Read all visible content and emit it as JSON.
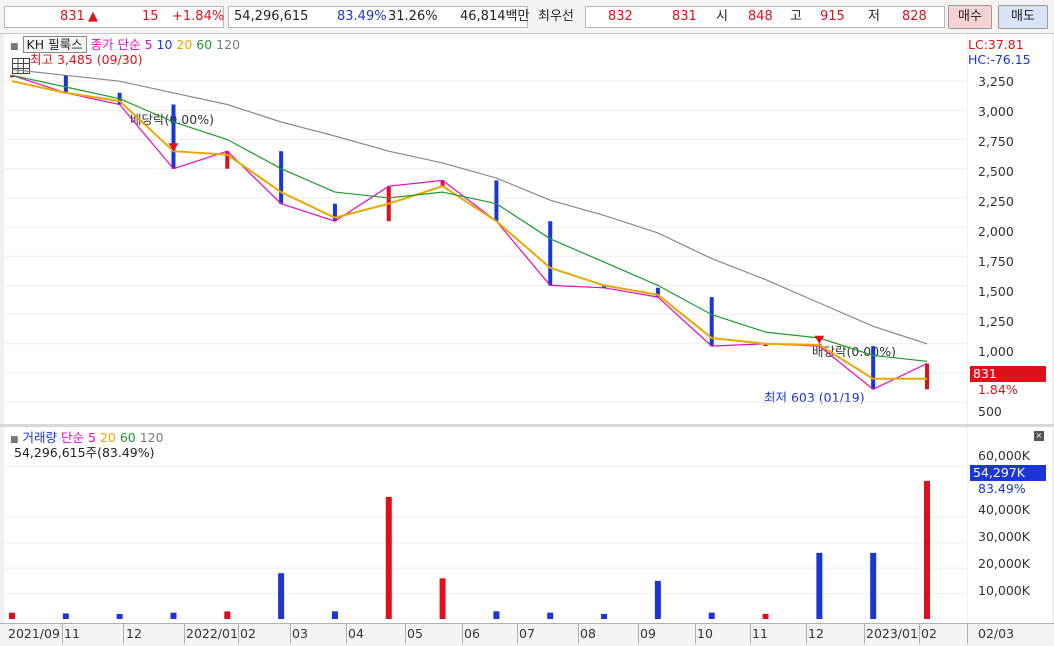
{
  "header": {
    "price": "831",
    "arrow": "▲",
    "change": "15",
    "change_pct": "+1.84%",
    "volume": "54,296,615",
    "vol_ratio": "83.49%",
    "turnover": "31.26%",
    "amount": "46,814백만",
    "best_label": "최우선",
    "best_ask": "832",
    "best_bid": "831",
    "open_label": "시",
    "open": "848",
    "high_label": "고",
    "high": "915",
    "low_label": "저",
    "low": "828",
    "buy_label": "매수",
    "sell_label": "매도"
  },
  "price_panel": {
    "stock_name": "KH 필룩스",
    "legend_close": "종가",
    "legend_simple": "단순",
    "ma_labels": [
      "5",
      "10",
      "20",
      "60",
      "120"
    ],
    "ma_colors": [
      "#e40cc2",
      "#1a36d6",
      "#e8a800",
      "#1f9a2e",
      "#7a7a7a"
    ],
    "lc_label": "LC:37.81",
    "hc_label": "HC:-76.15",
    "high_annotation": "최고 3,485 (09/30)",
    "low_annotation": "최저 603 (01/19)",
    "dividend_label_1": "배당락(0.00%)",
    "dividend_label_2": "배당락(0.00%)",
    "current_price_tag": "831",
    "current_pct_tag": "1.84%"
  },
  "volume_panel": {
    "title": "거래량",
    "legend_simple": "단순",
    "ma_labels": [
      "5",
      "20",
      "60",
      "120"
    ],
    "ma_colors": [
      "#e40cc2",
      "#e8a800",
      "#1f9a2e",
      "#7a7a7a"
    ],
    "summary": "54,296,615주(83.49%)",
    "current_tag": "54,297K",
    "current_pct_tag": "83.49%"
  },
  "y_ticks_price": [
    "3,250",
    "3,000",
    "2,750",
    "2,500",
    "2,250",
    "2,000",
    "1,750",
    "1,500",
    "1,250",
    "1,000",
    "500"
  ],
  "y_ticks_volume": [
    "60,000K",
    "40,000K",
    "30,000K",
    "20,000K",
    "10,000K"
  ],
  "x_ticks": [
    "2021/09",
    "11",
    "12",
    "2022/01",
    "02",
    "03",
    "04",
    "05",
    "06",
    "07",
    "08",
    "09",
    "10",
    "11",
    "12",
    "2023/01",
    "02",
    "02/03"
  ],
  "colors": {
    "up": "#e0101a",
    "down": "#1a36d6",
    "accent_tag": "#e0101a",
    "vol_tag": "#1a36d6"
  },
  "chart_data": [
    {
      "type": "line",
      "title": "KH 필룩스",
      "x": [
        "2021/09",
        "2021/10",
        "2021/11",
        "2021/12",
        "2022/01",
        "2022/02",
        "2022/03",
        "2022/04",
        "2022/05",
        "2022/06",
        "2022/07",
        "2022/08",
        "2022/09",
        "2022/10",
        "2022/11",
        "2022/12",
        "2023/01",
        "2023/02"
      ],
      "ylim": [
        450,
        3500
      ],
      "series": [
        {
          "name": "종가",
          "values": [
            3300,
            3150,
            3050,
            2500,
            2650,
            2200,
            2050,
            2350,
            2400,
            2050,
            1500,
            1480,
            1400,
            980,
            1000,
            980,
            610,
            831
          ]
        },
        {
          "name": "20",
          "values": [
            3250,
            3150,
            3080,
            2650,
            2620,
            2300,
            2080,
            2200,
            2350,
            2050,
            1650,
            1500,
            1420,
            1050,
            1000,
            990,
            700,
            700
          ]
        },
        {
          "name": "60",
          "values": [
            3300,
            3200,
            3100,
            2900,
            2750,
            2500,
            2300,
            2250,
            2300,
            2200,
            1900,
            1700,
            1500,
            1250,
            1100,
            1050,
            900,
            850
          ]
        },
        {
          "name": "120",
          "values": [
            3350,
            3300,
            3250,
            3150,
            3050,
            2900,
            2780,
            2650,
            2550,
            2420,
            2230,
            2100,
            1950,
            1730,
            1550,
            1350,
            1150,
            1000
          ]
        }
      ]
    },
    {
      "type": "bar",
      "title": "거래량",
      "x": [
        "2021/09",
        "2021/10",
        "2021/11",
        "2021/12",
        "2022/01",
        "2022/02",
        "2022/03",
        "2022/04",
        "2022/05",
        "2022/06",
        "2022/07",
        "2022/08",
        "2022/09",
        "2022/10",
        "2022/11",
        "2022/12",
        "2023/01",
        "2023/02"
      ],
      "ylim": [
        0,
        70000
      ],
      "series": [
        {
          "name": "거래량",
          "values": [
            2500,
            2200,
            2000,
            2500,
            3000,
            18000,
            3000,
            48000,
            16000,
            3000,
            2500,
            2000,
            15000,
            2500,
            2000,
            26000,
            26000,
            54297
          ]
        }
      ]
    }
  ]
}
